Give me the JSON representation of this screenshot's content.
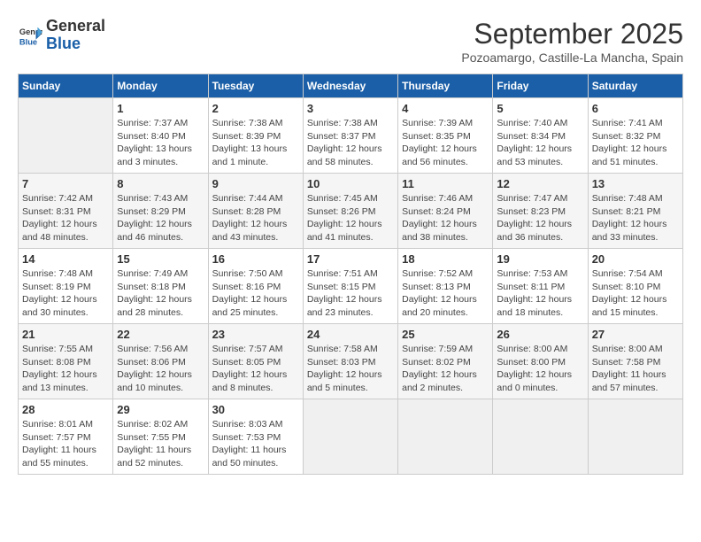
{
  "logo": {
    "line1": "General",
    "line2": "Blue"
  },
  "title": "September 2025",
  "subtitle": "Pozoamargo, Castille-La Mancha, Spain",
  "weekdays": [
    "Sunday",
    "Monday",
    "Tuesday",
    "Wednesday",
    "Thursday",
    "Friday",
    "Saturday"
  ],
  "weeks": [
    [
      {
        "day": "",
        "sunrise": "",
        "sunset": "",
        "daylight": ""
      },
      {
        "day": "1",
        "sunrise": "Sunrise: 7:37 AM",
        "sunset": "Sunset: 8:40 PM",
        "daylight": "Daylight: 13 hours and 3 minutes."
      },
      {
        "day": "2",
        "sunrise": "Sunrise: 7:38 AM",
        "sunset": "Sunset: 8:39 PM",
        "daylight": "Daylight: 13 hours and 1 minute."
      },
      {
        "day": "3",
        "sunrise": "Sunrise: 7:38 AM",
        "sunset": "Sunset: 8:37 PM",
        "daylight": "Daylight: 12 hours and 58 minutes."
      },
      {
        "day": "4",
        "sunrise": "Sunrise: 7:39 AM",
        "sunset": "Sunset: 8:35 PM",
        "daylight": "Daylight: 12 hours and 56 minutes."
      },
      {
        "day": "5",
        "sunrise": "Sunrise: 7:40 AM",
        "sunset": "Sunset: 8:34 PM",
        "daylight": "Daylight: 12 hours and 53 minutes."
      },
      {
        "day": "6",
        "sunrise": "Sunrise: 7:41 AM",
        "sunset": "Sunset: 8:32 PM",
        "daylight": "Daylight: 12 hours and 51 minutes."
      }
    ],
    [
      {
        "day": "7",
        "sunrise": "Sunrise: 7:42 AM",
        "sunset": "Sunset: 8:31 PM",
        "daylight": "Daylight: 12 hours and 48 minutes."
      },
      {
        "day": "8",
        "sunrise": "Sunrise: 7:43 AM",
        "sunset": "Sunset: 8:29 PM",
        "daylight": "Daylight: 12 hours and 46 minutes."
      },
      {
        "day": "9",
        "sunrise": "Sunrise: 7:44 AM",
        "sunset": "Sunset: 8:28 PM",
        "daylight": "Daylight: 12 hours and 43 minutes."
      },
      {
        "day": "10",
        "sunrise": "Sunrise: 7:45 AM",
        "sunset": "Sunset: 8:26 PM",
        "daylight": "Daylight: 12 hours and 41 minutes."
      },
      {
        "day": "11",
        "sunrise": "Sunrise: 7:46 AM",
        "sunset": "Sunset: 8:24 PM",
        "daylight": "Daylight: 12 hours and 38 minutes."
      },
      {
        "day": "12",
        "sunrise": "Sunrise: 7:47 AM",
        "sunset": "Sunset: 8:23 PM",
        "daylight": "Daylight: 12 hours and 36 minutes."
      },
      {
        "day": "13",
        "sunrise": "Sunrise: 7:48 AM",
        "sunset": "Sunset: 8:21 PM",
        "daylight": "Daylight: 12 hours and 33 minutes."
      }
    ],
    [
      {
        "day": "14",
        "sunrise": "Sunrise: 7:48 AM",
        "sunset": "Sunset: 8:19 PM",
        "daylight": "Daylight: 12 hours and 30 minutes."
      },
      {
        "day": "15",
        "sunrise": "Sunrise: 7:49 AM",
        "sunset": "Sunset: 8:18 PM",
        "daylight": "Daylight: 12 hours and 28 minutes."
      },
      {
        "day": "16",
        "sunrise": "Sunrise: 7:50 AM",
        "sunset": "Sunset: 8:16 PM",
        "daylight": "Daylight: 12 hours and 25 minutes."
      },
      {
        "day": "17",
        "sunrise": "Sunrise: 7:51 AM",
        "sunset": "Sunset: 8:15 PM",
        "daylight": "Daylight: 12 hours and 23 minutes."
      },
      {
        "day": "18",
        "sunrise": "Sunrise: 7:52 AM",
        "sunset": "Sunset: 8:13 PM",
        "daylight": "Daylight: 12 hours and 20 minutes."
      },
      {
        "day": "19",
        "sunrise": "Sunrise: 7:53 AM",
        "sunset": "Sunset: 8:11 PM",
        "daylight": "Daylight: 12 hours and 18 minutes."
      },
      {
        "day": "20",
        "sunrise": "Sunrise: 7:54 AM",
        "sunset": "Sunset: 8:10 PM",
        "daylight": "Daylight: 12 hours and 15 minutes."
      }
    ],
    [
      {
        "day": "21",
        "sunrise": "Sunrise: 7:55 AM",
        "sunset": "Sunset: 8:08 PM",
        "daylight": "Daylight: 12 hours and 13 minutes."
      },
      {
        "day": "22",
        "sunrise": "Sunrise: 7:56 AM",
        "sunset": "Sunset: 8:06 PM",
        "daylight": "Daylight: 12 hours and 10 minutes."
      },
      {
        "day": "23",
        "sunrise": "Sunrise: 7:57 AM",
        "sunset": "Sunset: 8:05 PM",
        "daylight": "Daylight: 12 hours and 8 minutes."
      },
      {
        "day": "24",
        "sunrise": "Sunrise: 7:58 AM",
        "sunset": "Sunset: 8:03 PM",
        "daylight": "Daylight: 12 hours and 5 minutes."
      },
      {
        "day": "25",
        "sunrise": "Sunrise: 7:59 AM",
        "sunset": "Sunset: 8:02 PM",
        "daylight": "Daylight: 12 hours and 2 minutes."
      },
      {
        "day": "26",
        "sunrise": "Sunrise: 8:00 AM",
        "sunset": "Sunset: 8:00 PM",
        "daylight": "Daylight: 12 hours and 0 minutes."
      },
      {
        "day": "27",
        "sunrise": "Sunrise: 8:00 AM",
        "sunset": "Sunset: 7:58 PM",
        "daylight": "Daylight: 11 hours and 57 minutes."
      }
    ],
    [
      {
        "day": "28",
        "sunrise": "Sunrise: 8:01 AM",
        "sunset": "Sunset: 7:57 PM",
        "daylight": "Daylight: 11 hours and 55 minutes."
      },
      {
        "day": "29",
        "sunrise": "Sunrise: 8:02 AM",
        "sunset": "Sunset: 7:55 PM",
        "daylight": "Daylight: 11 hours and 52 minutes."
      },
      {
        "day": "30",
        "sunrise": "Sunrise: 8:03 AM",
        "sunset": "Sunset: 7:53 PM",
        "daylight": "Daylight: 11 hours and 50 minutes."
      },
      {
        "day": "",
        "sunrise": "",
        "sunset": "",
        "daylight": ""
      },
      {
        "day": "",
        "sunrise": "",
        "sunset": "",
        "daylight": ""
      },
      {
        "day": "",
        "sunrise": "",
        "sunset": "",
        "daylight": ""
      },
      {
        "day": "",
        "sunrise": "",
        "sunset": "",
        "daylight": ""
      }
    ]
  ]
}
